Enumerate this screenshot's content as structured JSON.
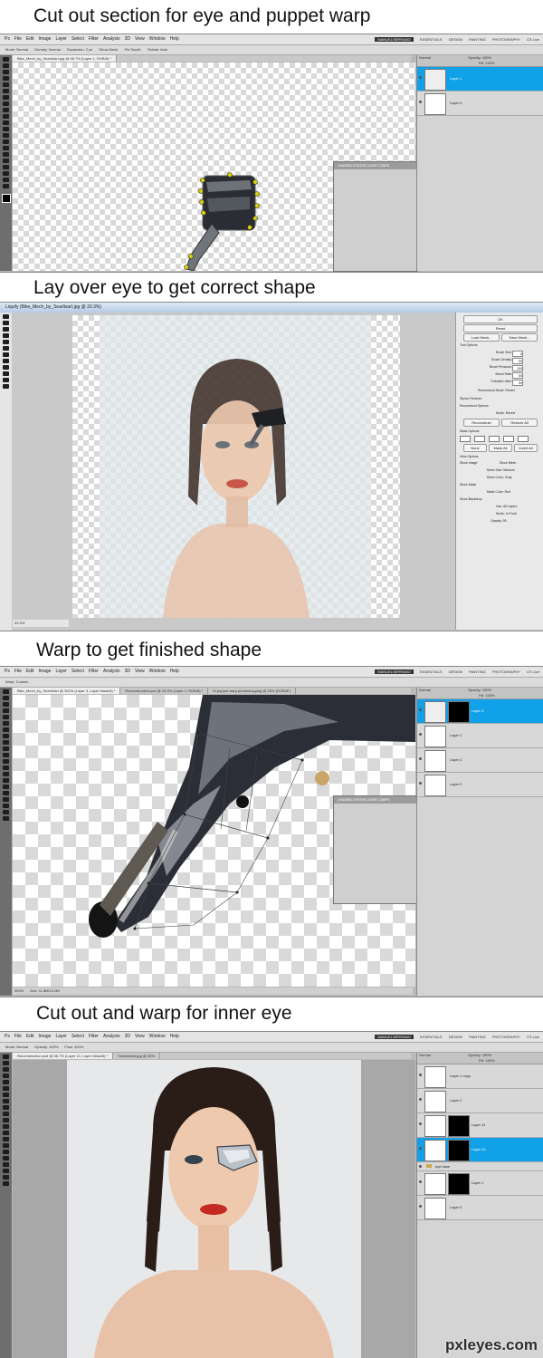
{
  "sections": [
    {
      "caption": "Cut out section for eye and puppet warp"
    },
    {
      "caption": "Lay over eye to get correct shape"
    },
    {
      "caption": "Warp to get finished shape"
    },
    {
      "caption": "Cut out and warp for inner eye"
    }
  ],
  "photoshop": {
    "menu": [
      "Ps",
      "File",
      "Edit",
      "Image",
      "Layer",
      "Select",
      "Filter",
      "Analysis",
      "3D",
      "View",
      "Window",
      "Help"
    ],
    "workspaces": [
      "ESSENTIALS",
      "DESIGN",
      "PAINTING",
      "PHOTOGRAPHY"
    ],
    "active_workspace": "MANUELSERRANO",
    "cs_live": "CS Live",
    "panel_tabs": [
      "LAYERS",
      "CHANNELS",
      "PATHS"
    ],
    "float_tabs": [
      "CHANNELS",
      "PATHS",
      "LAYER COMPS"
    ],
    "blend_mode": "Normal",
    "opacity_label": "Opacity:",
    "opacity": "100%",
    "fill_label": "Fill:",
    "fill": "100%"
  },
  "shot1": {
    "options": [
      "Mode: Normal",
      "Density: Normal",
      "Expansion: 2 px",
      "Show Mesh",
      "Pin Depth:",
      "Rotate: Auto"
    ],
    "tab": "Bike_Mech_by_SearlisArt.jpg @ 66.7% (Layer 1, RGB/8) *",
    "layers": [
      {
        "name": "Layer 1",
        "selected": true
      },
      {
        "name": "Layer 0",
        "selected": false
      }
    ]
  },
  "shot2": {
    "title": "Liquify (Bike_Mech_by_Searlisart.jpg @ 33.3%)",
    "zoom": "33.3%",
    "buttons": {
      "ok": "OK",
      "reset": "Reset",
      "load_mesh": "Load Mesh...",
      "save_mesh": "Save Mesh..."
    },
    "tool_options_title": "Tool Options",
    "tool_options": [
      {
        "label": "Brush Size:",
        "value": "5"
      },
      {
        "label": "Brush Density:",
        "value": "50"
      },
      {
        "label": "Brush Pressure:",
        "value": "100"
      },
      {
        "label": "Brush Rate:",
        "value": "80"
      },
      {
        "label": "Turbulent Jitter:",
        "value": "50"
      }
    ],
    "reconstruct_mode": "Reconstruct Mode:",
    "reconstruct_mode_value": "Revert",
    "stylus_pressure": "Stylus Pressure",
    "reconstruct_options": "Reconstruct Options",
    "mode_label": "Mode:",
    "mode_value": "Revert",
    "reconstruct": "Reconstruct",
    "restore_all": "Restore All",
    "mask_options": "Mask Options",
    "mask_buttons": {
      "none": "None",
      "mask_all": "Mask All",
      "invert_all": "Invert All"
    },
    "view_options": "View Options",
    "show_image": "Show Image",
    "show_mesh": "Show Mesh",
    "mesh_size": "Mesh Size:",
    "mesh_size_value": "Medium",
    "mesh_color": "Mesh Color:",
    "mesh_color_value": "Gray",
    "show_mask": "Show Mask",
    "mask_color": "Mask Color:",
    "mask_color_value": "Red",
    "show_backdrop": "Show Backdrop",
    "use_label": "Use:",
    "use_value": "All Layers",
    "backdrop_mode_label": "Mode:",
    "backdrop_mode_value": "In Front",
    "backdrop_opacity_label": "Opacity:",
    "backdrop_opacity": "50"
  },
  "shot3": {
    "options": [
      "Warp: Custom"
    ],
    "tabs": [
      "Bike_Mech_by_SearlisArt @ 300% (Layer 3, Layer Mask/8) *",
      "Reconstruction.psd @ 33.3% (Layer 1, RGB/8) *",
      "Kl.puppet warp.photoshopping @ 50% (RGB/8*)"
    ],
    "zoom": "300%",
    "doc": "Doc: 11.8M/13.0M",
    "layers": [
      {
        "name": "Layer 3",
        "selected": true,
        "mask": true
      },
      {
        "name": "Layer 1",
        "selected": false,
        "mask": false
      },
      {
        "name": "Layer 2",
        "selected": false,
        "mask": false
      },
      {
        "name": "Layer 0",
        "selected": false,
        "mask": false
      }
    ]
  },
  "shot4": {
    "options": [
      "Mode: Normal",
      "Opacity: 100%",
      "Flow: 100%"
    ],
    "tabs": [
      "Reconstruction.psd @ 66.7% (Layer 10, Layer Mask/8) *",
      "Screenshot.jpg @ 50%"
    ],
    "layers": [
      {
        "name": "Layer 1 copy",
        "selected": false,
        "mask": false
      },
      {
        "name": "Layer 2",
        "selected": false,
        "mask": false
      },
      {
        "name": "Layer 11",
        "selected": false,
        "mask": true
      },
      {
        "name": "Layer 10",
        "selected": true,
        "mask": true
      },
      {
        "name": "eye base",
        "selected": false,
        "mask": false,
        "group": true
      },
      {
        "name": "Layer 1",
        "selected": false,
        "mask": true
      },
      {
        "name": "Layer 0",
        "selected": false,
        "mask": false
      }
    ]
  },
  "watermark": "pxleyes.com"
}
